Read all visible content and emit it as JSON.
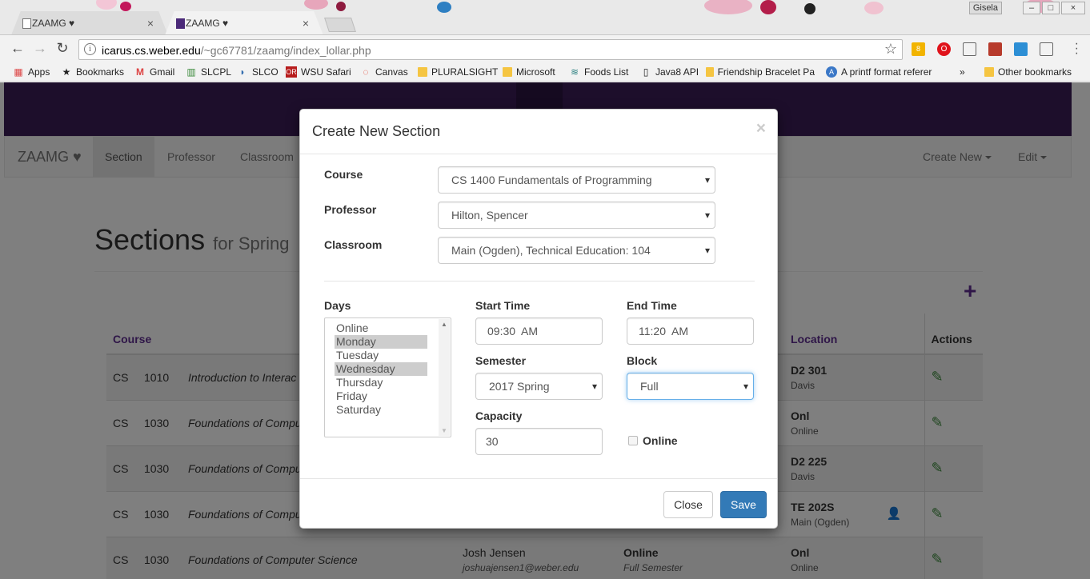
{
  "browser": {
    "tabs": [
      {
        "title": "ZAAMG ♥",
        "active": false
      },
      {
        "title": "ZAAMG ♥",
        "active": true
      }
    ],
    "profile_name": "Gisela",
    "url_host": "icarus.cs.weber.edu",
    "url_path": "/~gc67781/zaamg/index_lollar.php",
    "bookmarks": [
      {
        "label": "Apps",
        "icon": "apps-grid-icon"
      },
      {
        "label": "Bookmarks",
        "icon": "star-icon"
      },
      {
        "label": "Gmail",
        "icon": "gmail-icon"
      },
      {
        "label": "SLCPL",
        "icon": "slcpl-icon"
      },
      {
        "label": "SLCO",
        "icon": "slco-icon"
      },
      {
        "label": "WSU Safari",
        "icon": "safari-icon"
      },
      {
        "label": "Canvas",
        "icon": "canvas-icon"
      },
      {
        "label": "PLURALSIGHT",
        "icon": "folder-icon"
      },
      {
        "label": "Microsoft",
        "icon": "folder-icon"
      },
      {
        "label": "Foods List",
        "icon": "foods-icon"
      },
      {
        "label": "Java8 API",
        "icon": "page-icon"
      },
      {
        "label": "Friendship Bracelet Pa",
        "icon": "folder-icon"
      },
      {
        "label": "A printf format referer",
        "icon": "globe-icon"
      }
    ],
    "bookmarks_overflow": "»",
    "other_bookmarks": "Other bookmarks",
    "extension_badge": "8"
  },
  "site": {
    "brand": "ZAAMG ♥",
    "nav": [
      "Section",
      "Professor",
      "Classroom"
    ],
    "nav_right": [
      "Create New",
      "Edit"
    ],
    "page_title": "Sections",
    "page_subtitle": "for Spring"
  },
  "table": {
    "headers": {
      "course": "Course",
      "location": "Location",
      "actions": "Actions"
    },
    "rows": [
      {
        "prefix": "CS",
        "number": "1010",
        "title": "Introduction to Interac",
        "instructor": "",
        "instructor_email": "",
        "days": "",
        "block": "",
        "loc": "D2 301",
        "campus": "Davis",
        "has_person": false
      },
      {
        "prefix": "CS",
        "number": "1030",
        "title": "Foundations of Compu",
        "instructor": "",
        "instructor_email": "",
        "days": "",
        "block": "",
        "loc": "Onl",
        "campus": "Online",
        "has_person": false
      },
      {
        "prefix": "CS",
        "number": "1030",
        "title": "Foundations of Compu",
        "instructor": "",
        "instructor_email": "",
        "days": "",
        "block": "",
        "loc": "D2 225",
        "campus": "Davis",
        "has_person": false
      },
      {
        "prefix": "CS",
        "number": "1030",
        "title": "Foundations of Compu",
        "instructor": "",
        "instructor_email": "",
        "days": "",
        "block": "",
        "loc": "TE 202S",
        "campus": "Main (Ogden)",
        "has_person": true
      },
      {
        "prefix": "CS",
        "number": "1030",
        "title": "Foundations of Computer Science",
        "instructor": "Josh Jensen",
        "instructor_email": "joshuajensen1@weber.edu",
        "days": "Online",
        "block": "Full Semester",
        "loc": "Onl",
        "campus": "Online",
        "has_person": false
      }
    ]
  },
  "modal": {
    "title": "Create New Section",
    "close_x": "×",
    "course_label": "Course",
    "course_value": "CS 1400 Fundamentals of Programming",
    "professor_label": "Professor",
    "professor_value": "Hilton, Spencer",
    "classroom_label": "Classroom",
    "classroom_value": "Main (Ogden), Technical Education: 104",
    "days_label": "Days",
    "days_options": [
      "Online",
      "Monday",
      "Tuesday",
      "Wednesday",
      "Thursday",
      "Friday",
      "Saturday"
    ],
    "days_selected": [
      "Monday",
      "Wednesday"
    ],
    "start_time_label": "Start Time",
    "start_time_value": "09:30  AM",
    "end_time_label": "End Time",
    "end_time_value": "11:20  AM",
    "semester_label": "Semester",
    "semester_value": "2017 Spring",
    "block_label": "Block",
    "block_value": "Full",
    "capacity_label": "Capacity",
    "capacity_value": "30",
    "online_label": "Online",
    "close_button": "Close",
    "save_button": "Save"
  },
  "colors": {
    "brand_purple": "#3a1d57",
    "link_purple": "#5e2d91",
    "primary": "#337ab7",
    "edit_green": "#3c8a3c"
  }
}
